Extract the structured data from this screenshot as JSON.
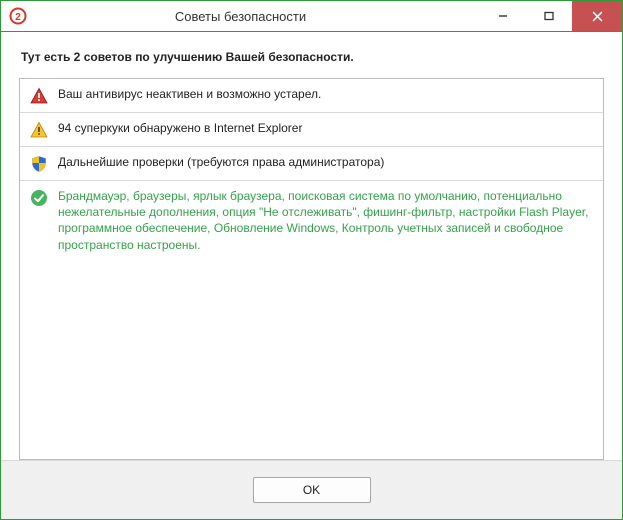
{
  "window": {
    "title": "Советы безопасности",
    "app_badge": "2"
  },
  "intro": "Тут есть 2 советов по улучшению Вашей безопасности.",
  "rows": {
    "danger": "Ваш антивирус неактивен и возможно устарел.",
    "warning": "94 суперкуки обнаружено в Internet Explorer",
    "shield": "Дальнейшие проверки (требуются права администратора)",
    "ok": "Брандмауэр, браузеры, ярлык браузера, поисковая система по умолчанию, потенциально нежелательные дополнения, опция \"Не отслеживать\", фишинг-фильтр, настройки Flash Player, программное обеспечение, Обновление Windows, Контроль учетных записей и свободное пространство настроены."
  },
  "footer": {
    "ok_label": "OK"
  }
}
